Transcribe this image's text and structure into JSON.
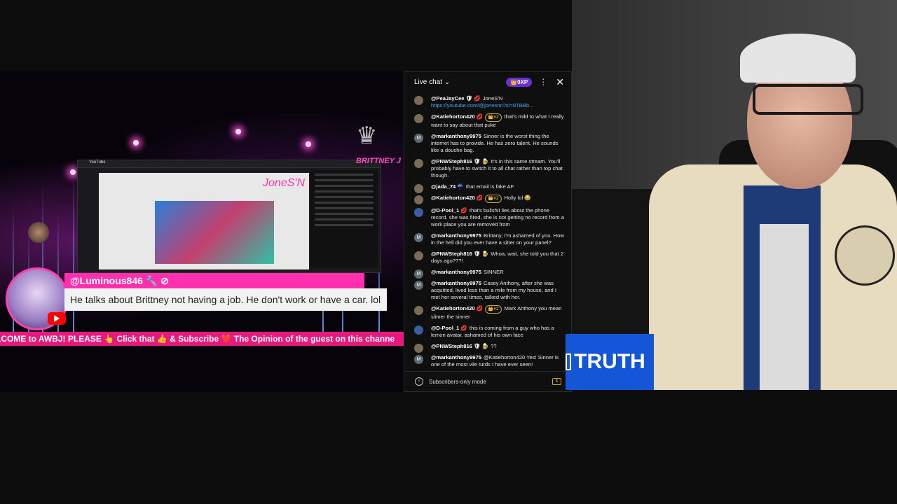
{
  "overlay": {
    "brand_text": "BRITTNEY J",
    "alert_username": "@Luminous846 🔧 ⊘",
    "alert_message": "He talks about Brittney not having a job. He don't work or have a car. lol",
    "ticker": "LCOME to AWBJ! PLEASE 👆 Click that 👍 & Subscribe ❤️ The Opinion of the guest on this channe",
    "inner_tab": "YouTube",
    "inner_watermark": "JoneS'N"
  },
  "chat": {
    "title": "Live chat",
    "xp_badge": "👑0XP",
    "messages": [
      {
        "author": "@PeaJayCee 🛡 💋",
        "badge": "",
        "text": "JoneS'N",
        "link": "https://youtube.com/@jonesnn?si=8TBBb..."
      },
      {
        "author": "@Katiehorton420 💋",
        "badge": "👑#2",
        "text": "that's mild to what I really want to say about that puke",
        "link": ""
      },
      {
        "author": "@markanthony9975",
        "badge": "",
        "text": "Sinner is the worst thing the internet has to provide. He has zero talent. He sounds like a douche bag.",
        "link": ""
      },
      {
        "author": "@PNWSteph816 🛡 🍺",
        "badge": "",
        "text": "It's in this same stream. You'll probably have to switch it to all chat rather than top chat though.",
        "link": ""
      },
      {
        "author": "@jada_74 ☔",
        "badge": "",
        "text": "that email is fake AF",
        "link": ""
      },
      {
        "author": "@Katiehorton420 💋",
        "badge": "👑#2",
        "text": "Holly lol 😂",
        "link": ""
      },
      {
        "author": "@D-Pool_1 💋",
        "badge": "",
        "text": "that's bullshit lies about the phone record. she was fired, she is not getting no record from a work place you are removed from",
        "link": ""
      },
      {
        "author": "@markanthony9975",
        "badge": "",
        "text": "Brittany, I'm ashamed of you. How in the hell did you ever have a sitter on your panel?",
        "link": ""
      },
      {
        "author": "@PNWSteph816 🛡 🍺",
        "badge": "",
        "text": "Whoa, wait, she told you that 2 days ago???!",
        "link": ""
      },
      {
        "author": "@markanthony9975",
        "badge": "",
        "text": "SINNER",
        "link": ""
      },
      {
        "author": "@markanthony9975",
        "badge": "",
        "text": "Casey Anthony, after she was acquitted, lived less than a mile from my house, and I met her several times, talked with her.",
        "link": ""
      },
      {
        "author": "@Katiehorton420 💋",
        "badge": "👑#2",
        "text": "Mark Anthony you mean slimer the sinner",
        "link": ""
      },
      {
        "author": "@D-Pool_1 💋",
        "badge": "",
        "text": "this is coming from a guy who has a lemon avatar. ashamed of his own face",
        "link": ""
      },
      {
        "author": "@PNWSteph816 🛡 🍺",
        "badge": "",
        "text": "??",
        "link": ""
      },
      {
        "author": "@markanthony9975",
        "badge": "",
        "text": "@Katiehorton420 Yes! Sinner is one of the most vile turds I have ever seen!",
        "link": ""
      }
    ],
    "footer": "Subscribers-only mode"
  },
  "webcam": {
    "label": "TRUTH"
  }
}
